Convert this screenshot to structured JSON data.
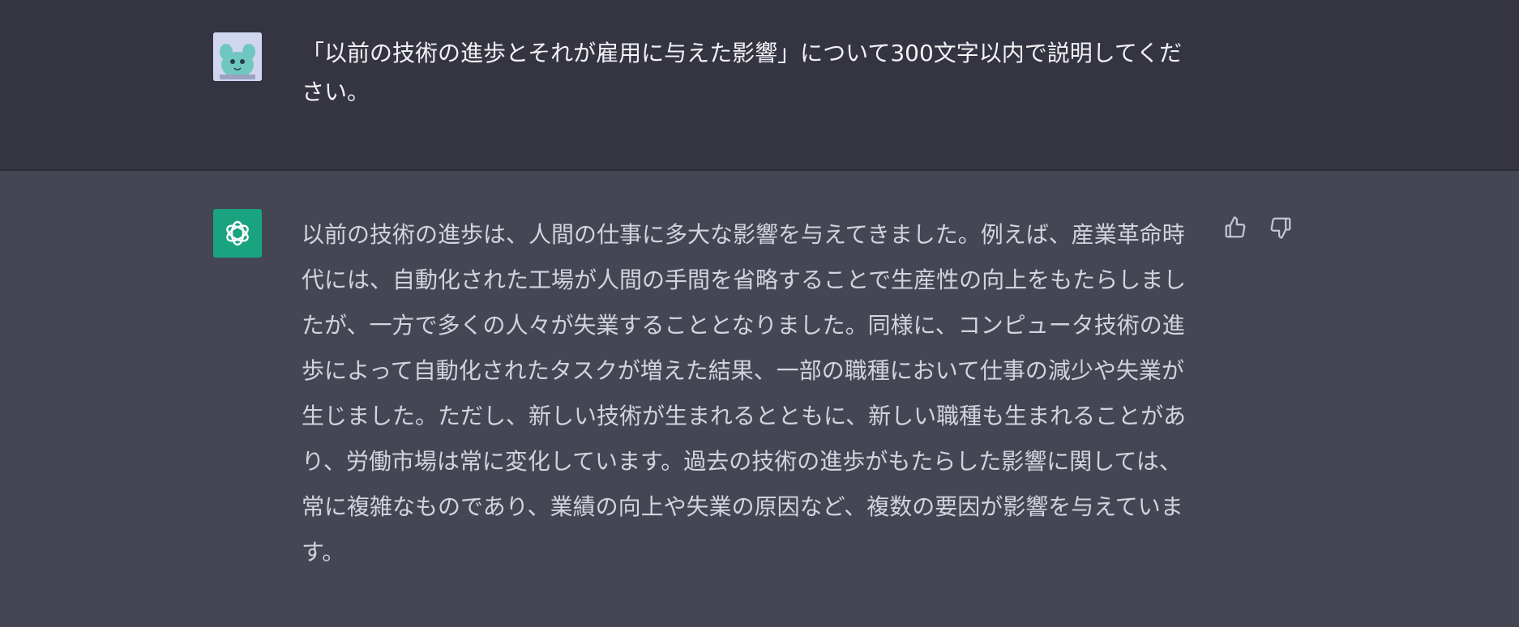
{
  "user_message": {
    "text": "「以前の技術の進歩とそれが雇用に与えた影響」について300文字以内で説明してください。"
  },
  "assistant_message": {
    "text": "以前の技術の進歩は、人間の仕事に多大な影響を与えてきました。例えば、産業革命時代には、自動化された工場が人間の手間を省略することで生産性の向上をもたらしましたが、一方で多くの人々が失業することとなりました。同様に、コンピュータ技術の進歩によって自動化されたタスクが増えた結果、一部の職種において仕事の減少や失業が生じました。ただし、新しい技術が生まれるとともに、新しい職種も生まれることがあり、労働市場は常に変化しています。過去の技術の進歩がもたらした影響に関しては、常に複雑なものであり、業績の向上や失業の原因など、複数の要因が影響を与えています。"
  },
  "colors": {
    "user_background": "#343541",
    "assistant_background": "#444654",
    "assistant_avatar": "#19a37f"
  },
  "icons": {
    "user_avatar": "creature-avatar-icon",
    "assistant_avatar": "openai-logo-icon",
    "feedback_up": "thumbs-up-icon",
    "feedback_down": "thumbs-down-icon"
  }
}
